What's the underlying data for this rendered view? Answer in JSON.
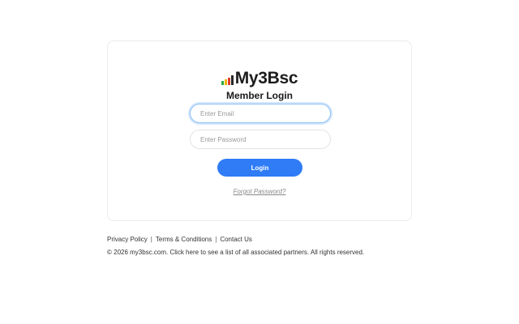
{
  "brand": {
    "name": "My3Bsc",
    "mark_colors": [
      "#2eaa3c",
      "#f0b400",
      "#e23b2e",
      "#2a2a2a"
    ],
    "mark_heights": [
      0.45,
      0.6,
      0.75,
      1.0
    ]
  },
  "login": {
    "heading": "Member Login",
    "email_placeholder": "Enter Email",
    "password_placeholder": "Enter Password",
    "submit_label": "Login",
    "forgot_label": "Forgot Password?"
  },
  "colors": {
    "accent": "#2f7cf6",
    "focus_ring": "#8fbff5"
  },
  "footer": {
    "links": [
      "Privacy Policy",
      "Terms & Conditions",
      "Contact Us"
    ],
    "separator": "|",
    "copyright_prefix": "© 2026  my3bsc.com. ",
    "copyright_link": "Click here",
    "copyright_suffix": " to see a list of all associated partners. All rights reserved."
  }
}
